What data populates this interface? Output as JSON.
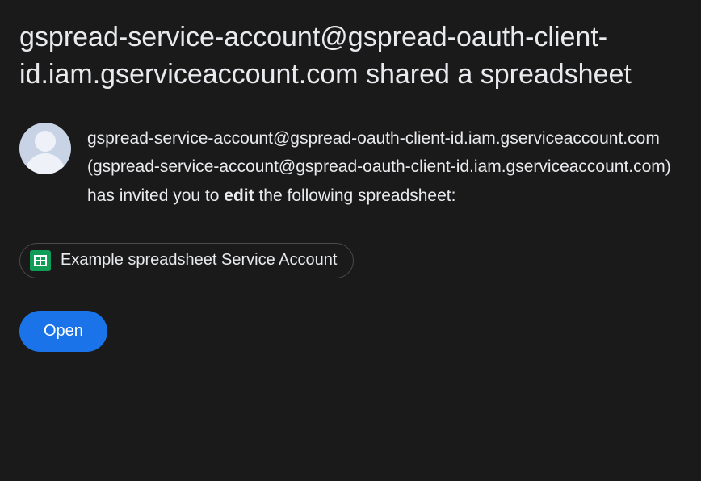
{
  "title": "gspread-service-account@gspread-oauth-client-id.iam.gserviceaccount.com shared a spreadsheet",
  "message": {
    "part1": "gspread-service-account@gspread-oauth-client-id.iam.gserviceaccount.com (gspread-service-account@gspread-oauth-client-id.iam.gserviceaccount.com) has invited you to ",
    "bold": "edit",
    "part2": " the following spreadsheet:"
  },
  "chip": {
    "label": "Example spreadsheet Service Account"
  },
  "button": {
    "open": "Open"
  }
}
